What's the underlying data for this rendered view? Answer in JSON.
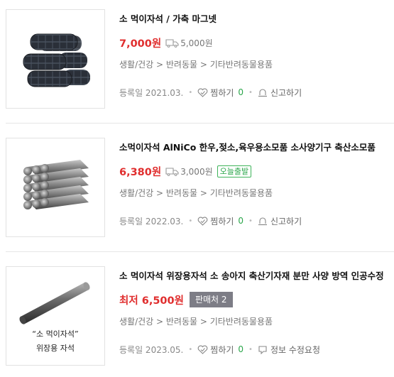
{
  "products": [
    {
      "title": "소 먹이자석 / 가축 마그넷",
      "price": "7,000원",
      "shipping": "5,000원",
      "badge": "",
      "category": "생활/건강 > 반려동물 > 기타반려동물용품",
      "registered": "등록일 2021.03.",
      "zzim_label": "찜하기",
      "zzim_count": "0",
      "action_label": "신고하기",
      "action_icon": "siren-icon",
      "image_desc": "dark wrapped magnets"
    },
    {
      "title": "소먹이자석 AlNiCo 한우,젖소,육우용소모품 소사양기구 축산소모품",
      "price": "6,380원",
      "shipping": "3,000원",
      "badge": "오늘출발",
      "category": "생활/건강 > 반려동물 > 기타반려동물용품",
      "registered": "등록일 2022.03.",
      "zzim_label": "찜하기",
      "zzim_count": "0",
      "action_label": "신고하기",
      "action_icon": "siren-icon"
    },
    {
      "title": "소 먹이자석 위장용자석 소 송아지 축산기자재 분만 사양 방역 인공수정",
      "price": "최저 6,500원",
      "shipping": "",
      "badge": "판매처 2",
      "category": "생활/건강 > 반려동물 > 기타반려동물용품",
      "registered": "등록일 2023.05.",
      "zzim_label": "찜하기",
      "zzim_count": "0",
      "action_label": "정보 수정요청",
      "action_icon": "edit-request-icon",
      "image_caption_line1": "“소 먹이자석”",
      "image_caption_line2": "위장용 자석"
    }
  ],
  "colors": {
    "price": "#e02e2e",
    "accent_green": "#2aa64a",
    "seller_badge_bg": "#7d7d86"
  }
}
